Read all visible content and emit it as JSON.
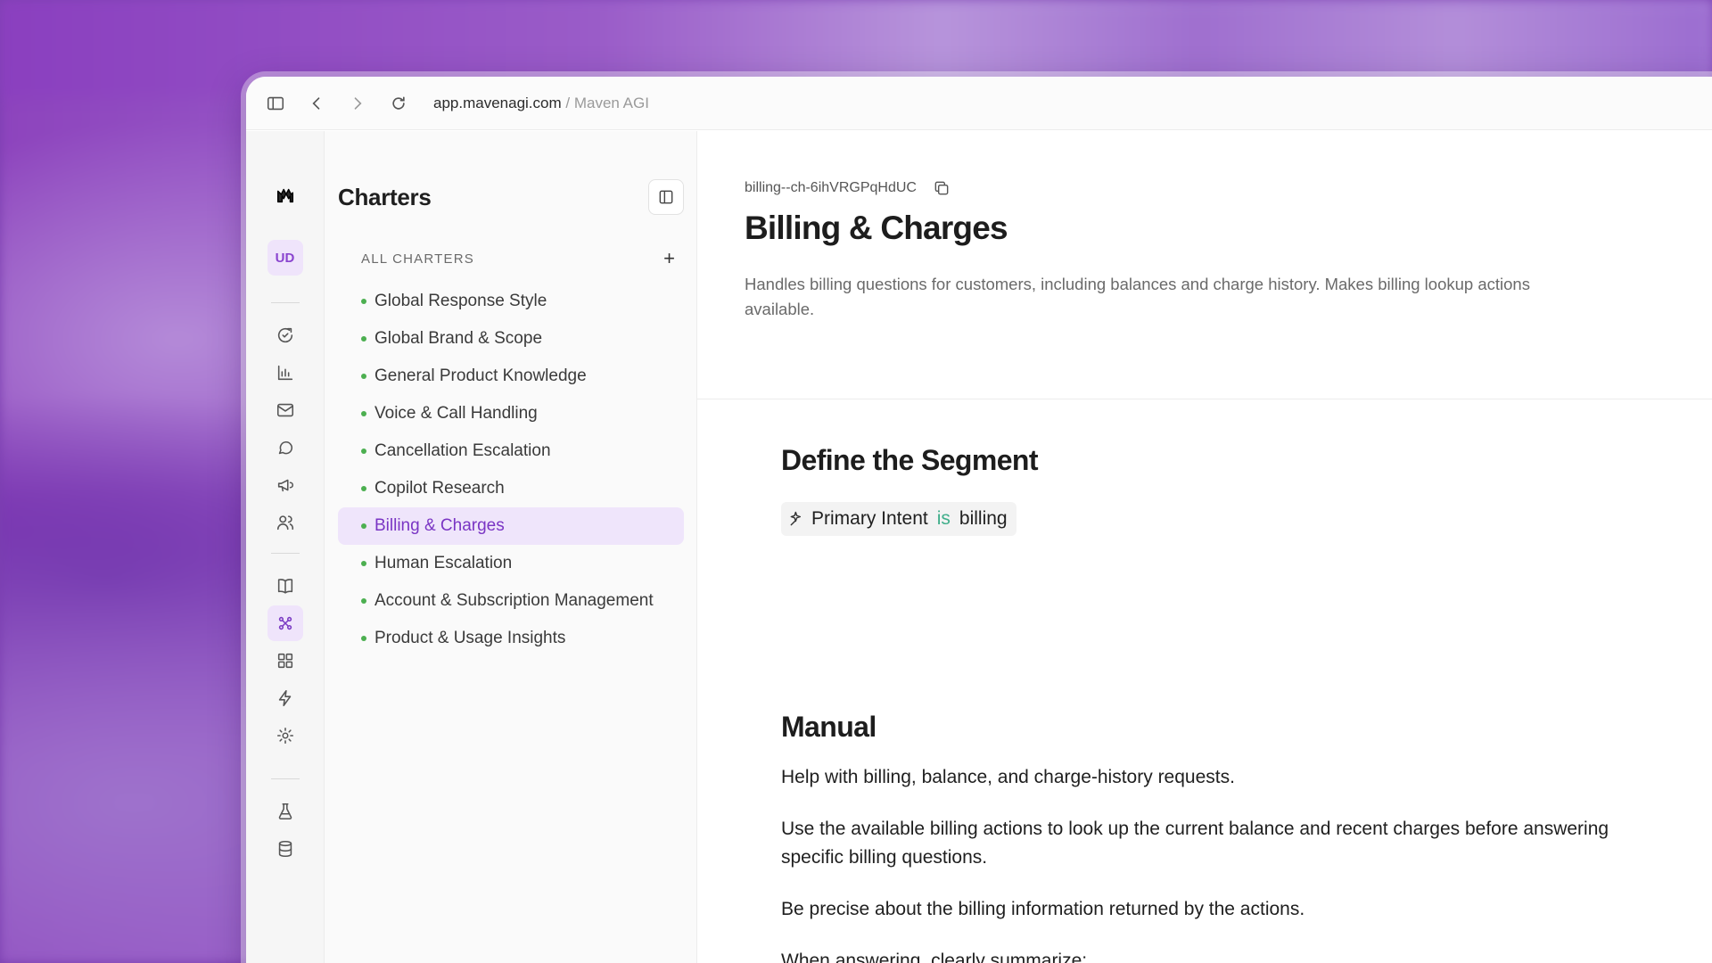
{
  "browser": {
    "url": "app.mavenagi.com",
    "separator": "/",
    "site_name": "Maven AGI"
  },
  "rail": {
    "avatar_initials": "UD",
    "accent_color": "#7b3cc4"
  },
  "charters": {
    "title": "Charters",
    "section_label": "ALL CHARTERS",
    "add_label": "+",
    "items": [
      {
        "label": "Global Response Style"
      },
      {
        "label": "Global Brand & Scope"
      },
      {
        "label": "General Product Knowledge"
      },
      {
        "label": "Voice & Call Handling"
      },
      {
        "label": "Cancellation Escalation"
      },
      {
        "label": "Copilot Research"
      },
      {
        "label": "Billing & Charges",
        "active": true
      },
      {
        "label": "Human Escalation"
      },
      {
        "label": "Account & Subscription Management"
      },
      {
        "label": "Product & Usage Insights"
      }
    ]
  },
  "charter": {
    "slug": "billing--ch-6ihVRGPqHdUC",
    "title": "Billing & Charges",
    "description": "Handles billing questions for customers, including balances and charge history. Makes billing lookup actions available."
  },
  "segment": {
    "heading": "Define the Segment",
    "field": "Primary Intent",
    "operator": "is",
    "value": "billing"
  },
  "manual": {
    "heading": "Manual",
    "paragraphs": [
      "Help with billing, balance, and charge-history requests.",
      "Use the available billing actions to look up the current balance and recent charges before answering specific billing questions.",
      "Be precise about the billing information returned by the actions.",
      "When answering, clearly summarize:"
    ]
  }
}
